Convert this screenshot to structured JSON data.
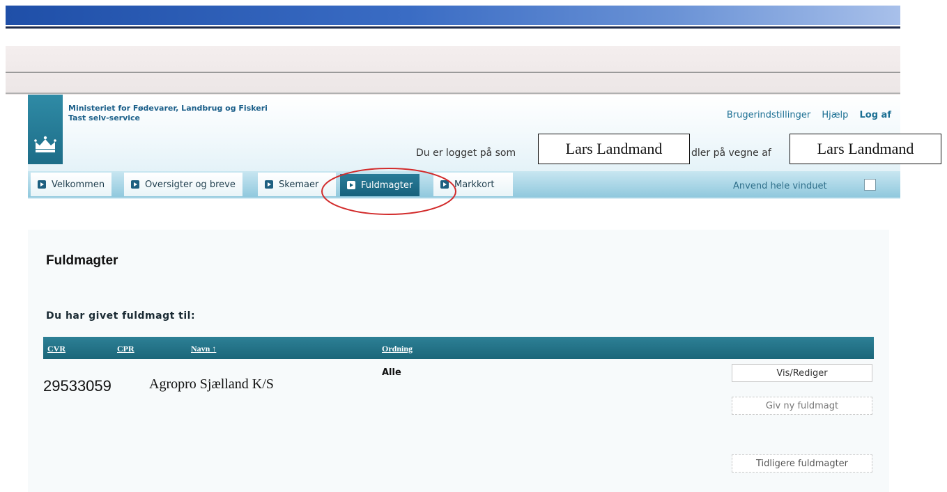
{
  "header": {
    "ministry_line1": "Ministeriet for Fødevarer, Landbrug og Fiskeri",
    "ministry_line2": "Tast selv-service",
    "links": {
      "settings": "Brugerindstillinger",
      "help": "Hjælp",
      "logout": "Log af"
    },
    "login_prefix": "Du er logget på som",
    "login_mid": "dler på vegne af",
    "user_name": "Lars Landmand",
    "acting_for": "Lars Landmand"
  },
  "tabs": [
    {
      "label": "Velkommen"
    },
    {
      "label": "Oversigter og breve"
    },
    {
      "label": "Skemaer"
    },
    {
      "label": "Fuldmagter"
    },
    {
      "label": "Markkort"
    }
  ],
  "whole_window_label": "Anvend hele vinduet",
  "page": {
    "title": "Fuldmagter",
    "section_title": "Du har givet fuldmagt til:"
  },
  "table": {
    "headers": {
      "cvr": "CVR",
      "cpr": "CPR",
      "navn": "Navn ↑",
      "ordning": "Ordning"
    },
    "rows": [
      {
        "cvr": "29533059",
        "navn": "Agropro Sjælland K/S",
        "ordning": "Alle"
      }
    ]
  },
  "buttons": {
    "edit": "Vis/Rediger",
    "new": "Giv ny fuldmagt",
    "previous": "Tidligere fuldmagter"
  },
  "colors": {
    "accent": "#1b6679",
    "highlight_circle": "#d22b2b",
    "top_bar": "#1f4fa8"
  }
}
